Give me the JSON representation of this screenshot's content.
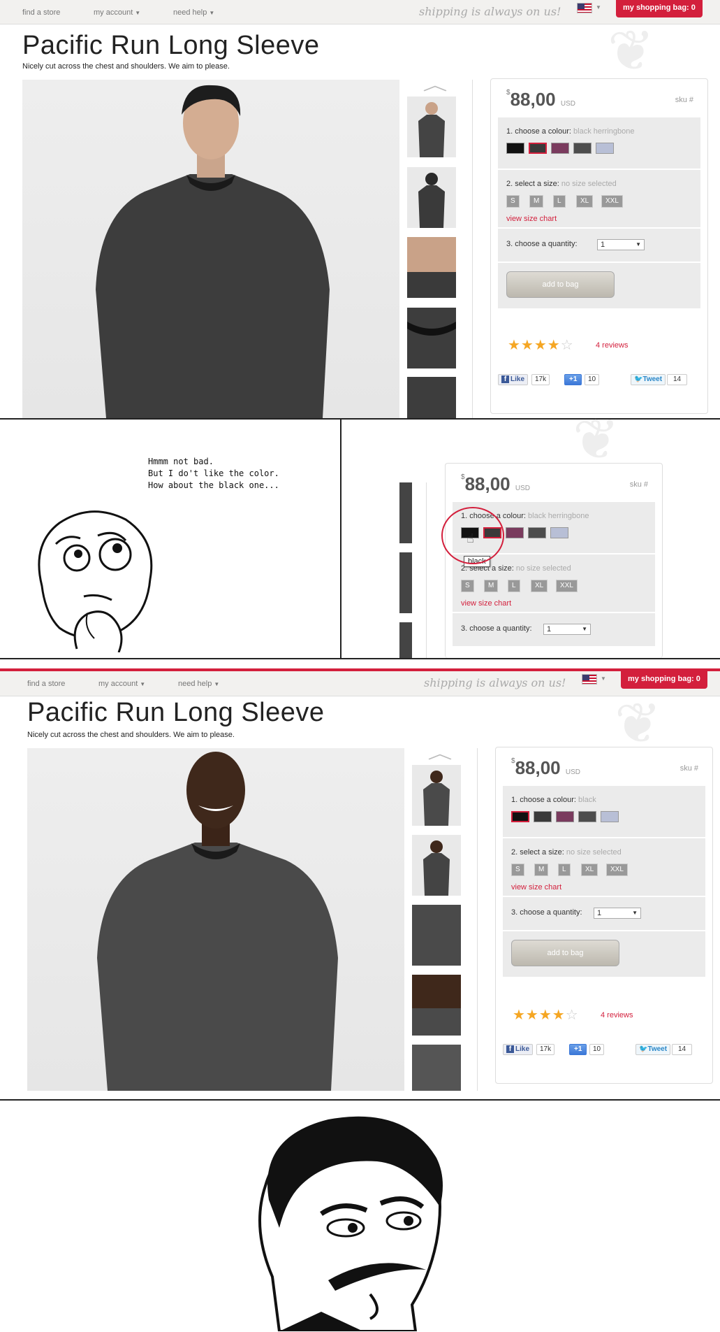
{
  "nav": {
    "find_store": "find a store",
    "my_account": "my account",
    "need_help": "need help",
    "promo": "shipping is always on us!",
    "bag": "my shopping bag: 0"
  },
  "product": {
    "title": "Pacific Run Long Sleeve",
    "subtitle": "Nicely cut across the chest and shoulders. We aim to please.",
    "currency_symbol": "$",
    "price": "88,00",
    "currency": "USD",
    "sku": "sku #",
    "colour_label": "1. choose a colour:",
    "size_label": "2. select a size:",
    "size_selected": "no size selected",
    "sizes": [
      "S",
      "M",
      "L",
      "XL",
      "XXL"
    ],
    "size_chart": "view size chart",
    "qty_label": "3. choose a quantity:",
    "qty_value": "1",
    "add_to_bag": "add to bag",
    "rating": 4,
    "reviews": "4 reviews",
    "like": "Like",
    "like_count": "17k",
    "gplus": "+1",
    "gplus_count": "10",
    "tweet": "Tweet",
    "tweet_count": "14",
    "swatch_colors": [
      "#111111",
      "#3a3a3a",
      "#7a3b5e",
      "#4d4d4d",
      "#b8bfd6"
    ]
  },
  "panel1": {
    "selected_colour": "black herringbone"
  },
  "panel2": {
    "speech": "Hmmm not bad.\nBut I do't like the color.\nHow about the black one...",
    "selected_colour": "black herringbone",
    "tooltip": "black"
  },
  "panel3": {
    "selected_colour": "black"
  }
}
